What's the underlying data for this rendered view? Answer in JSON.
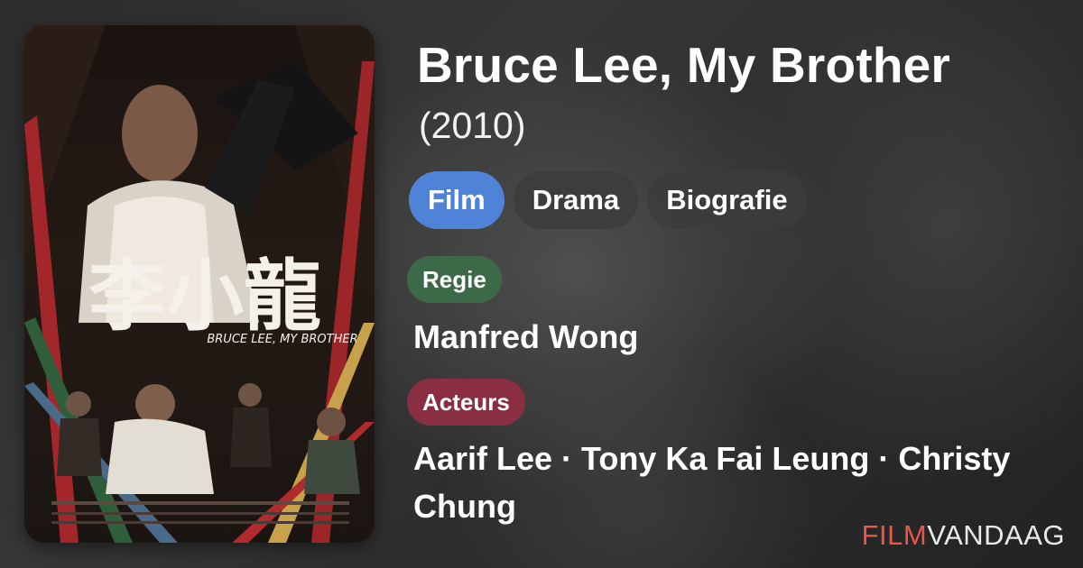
{
  "movie": {
    "title": "Bruce Lee, My Brother",
    "year": "(2010)"
  },
  "genres": [
    "Film",
    "Drama",
    "Biografie"
  ],
  "director": {
    "label": "Regie",
    "name": "Manfred Wong"
  },
  "cast": {
    "label": "Acteurs",
    "names": "Aarif Lee · Tony Ka Fai Leung · Christy Chung"
  },
  "brand": {
    "part1": "FILM",
    "part2": "VANDAAG"
  },
  "poster": {
    "chinese_title": "李小龍",
    "english_title": "BRUCE LEE, MY BROTHER"
  },
  "colors": {
    "genre_primary": "#4f83d8",
    "regie_badge": "#3c6a49",
    "acteurs_badge": "#8a2f43",
    "brand_accent": "#e8574a"
  }
}
